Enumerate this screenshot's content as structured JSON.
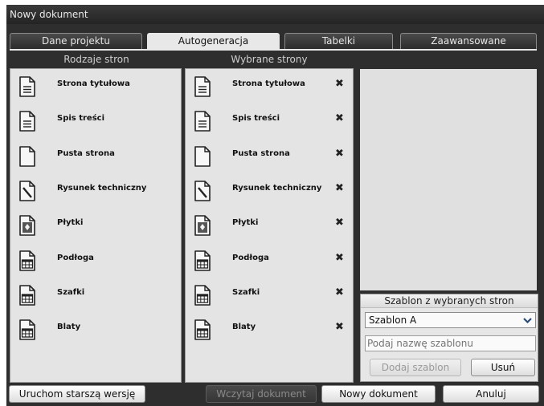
{
  "window": {
    "title": "Nowy dokument"
  },
  "tabs": [
    {
      "label": "Dane projektu",
      "active": false
    },
    {
      "label": "Autogeneracja",
      "active": true
    },
    {
      "label": "Tabelki",
      "active": false
    },
    {
      "label": "Zaawansowane",
      "active": false
    }
  ],
  "left_column": {
    "title": "Rodzaje stron",
    "items": [
      {
        "label": "Strona tytułowa",
        "icon": "document-lines-icon"
      },
      {
        "label": "Spis treści",
        "icon": "document-lines-icon"
      },
      {
        "label": "Pusta strona",
        "icon": "blank-page-icon"
      },
      {
        "label": "Rysunek techniczny",
        "icon": "pencil-page-icon"
      },
      {
        "label": "Płytki",
        "icon": "tiles-page-icon"
      },
      {
        "label": "Podłoga",
        "icon": "table-page-icon"
      },
      {
        "label": "Szafki",
        "icon": "table-page-icon"
      },
      {
        "label": "Blaty",
        "icon": "table-page-icon"
      }
    ]
  },
  "right_column": {
    "title": "Wybrane strony",
    "remove_glyph": "✖",
    "items": [
      {
        "label": "Strona tytułowa",
        "icon": "document-lines-icon"
      },
      {
        "label": "Spis treści",
        "icon": "document-lines-icon"
      },
      {
        "label": "Pusta strona",
        "icon": "blank-page-icon"
      },
      {
        "label": "Rysunek techniczny",
        "icon": "pencil-page-icon"
      },
      {
        "label": "Płytki",
        "icon": "tiles-page-icon"
      },
      {
        "label": "Podłoga",
        "icon": "table-page-icon"
      },
      {
        "label": "Szafki",
        "icon": "table-page-icon"
      },
      {
        "label": "Blaty",
        "icon": "table-page-icon"
      }
    ]
  },
  "template": {
    "title": "Szablon z wybranych stron",
    "selected": "Szablon A",
    "name_placeholder": "Podaj nazwę szablonu",
    "add_label": "Dodaj szablon",
    "remove_label": "Usuń"
  },
  "footer": {
    "old_version_label": "Uruchom starszą wersję",
    "load_label": "Wczytaj dokument",
    "new_label": "Nowy dokument",
    "cancel_label": "Anuluj"
  }
}
